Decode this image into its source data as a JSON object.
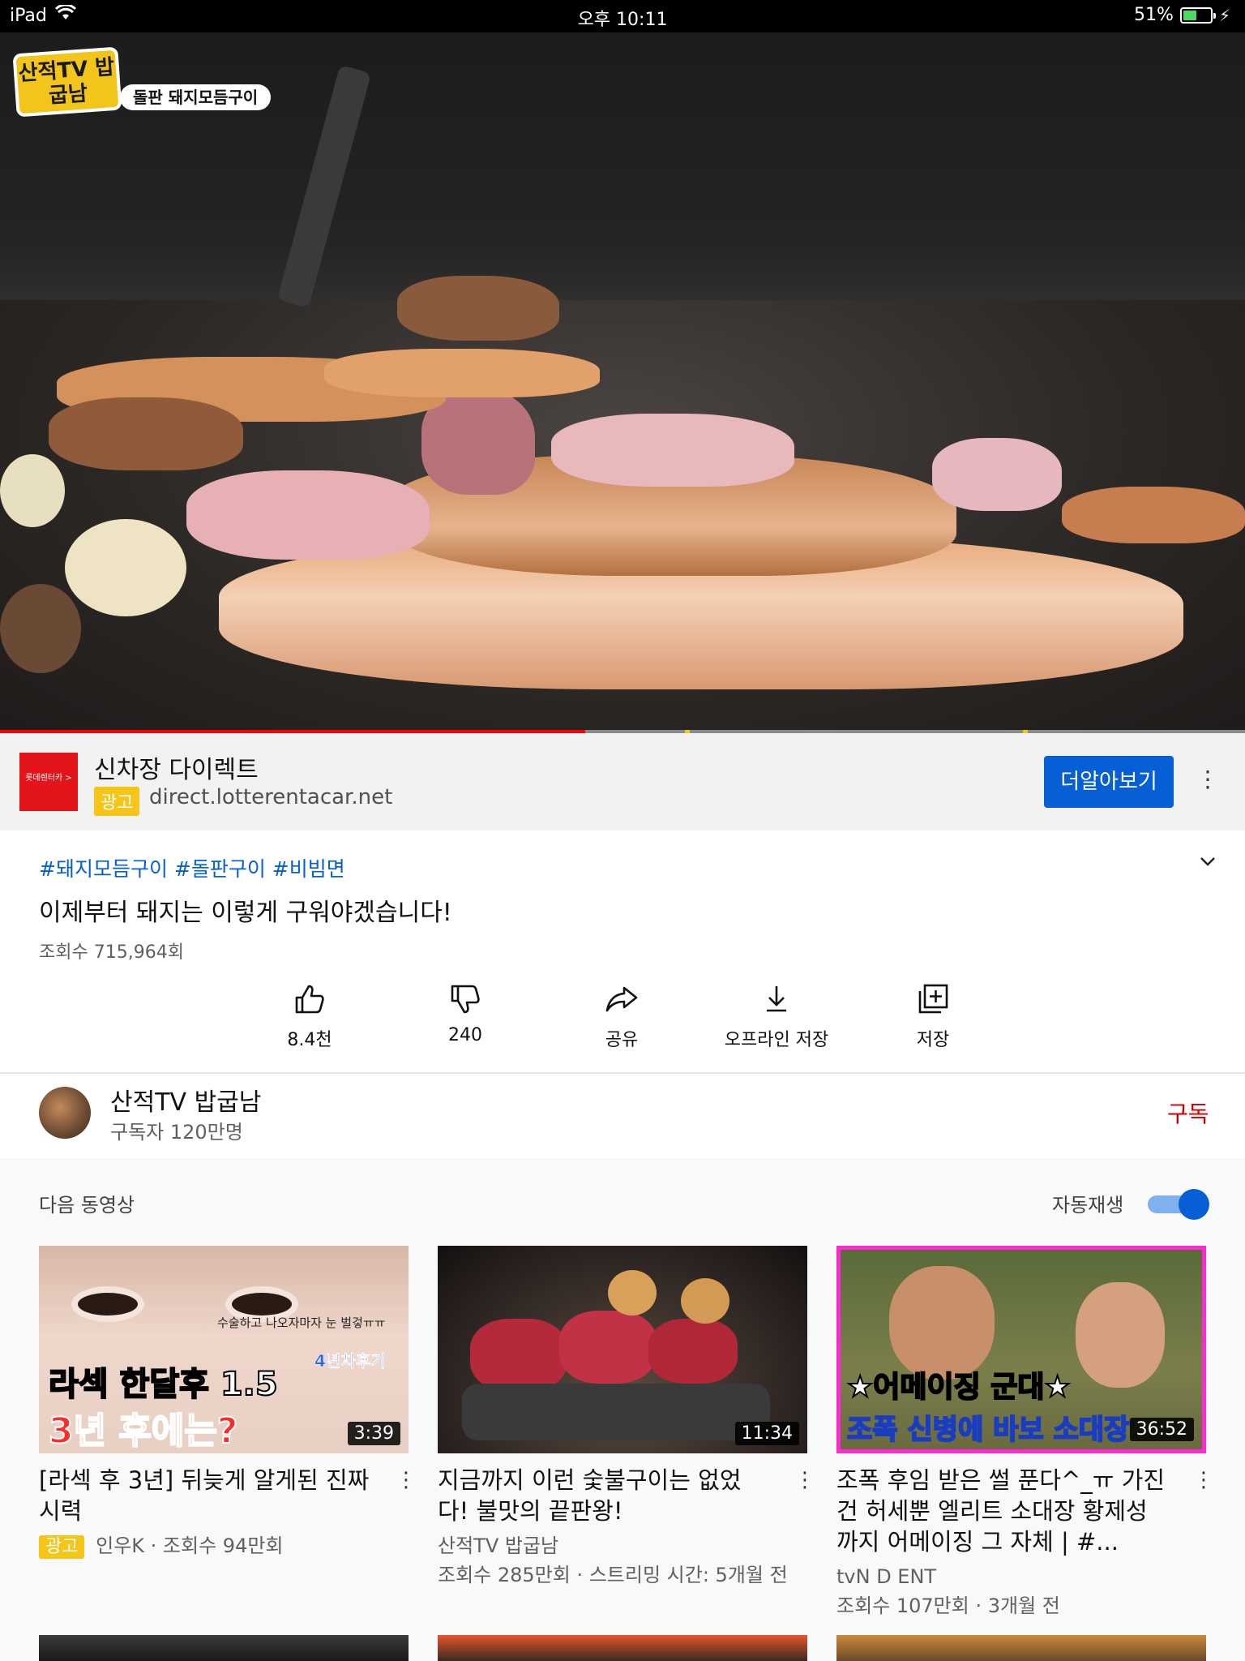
{
  "status_bar": {
    "device": "iPad",
    "time": "오후 10:11",
    "battery": "51%",
    "battery_level": 0.51
  },
  "video": {
    "channel_logo_text": "산적TV 밥굽남",
    "episode_label": "돌판 돼지모듬구이",
    "progress": 0.47
  },
  "ad": {
    "logo_text": "롯데렌터카 >",
    "title": "신차장 다이렉트",
    "badge": "광고",
    "url": "direct.lotterentacar.net",
    "cta": "더알아보기"
  },
  "info": {
    "hashtags": "#돼지모듬구이 #돌판구이 #비빔면",
    "title": "이제부터 돼지는 이렇게 구워야겠습니다!",
    "views": "조회수 715,964회"
  },
  "actions": [
    {
      "icon": "thumbs-up-icon",
      "label": "8.4천"
    },
    {
      "icon": "thumbs-down-icon",
      "label": "240"
    },
    {
      "icon": "share-icon",
      "label": "공유"
    },
    {
      "icon": "download-icon",
      "label": "오프라인 저장"
    },
    {
      "icon": "add-to-playlist-icon",
      "label": "저장"
    }
  ],
  "channel": {
    "name": "산적TV 밥굽남",
    "subscribers": "구독자 120만명",
    "subscribe_label": "구독"
  },
  "up_next": {
    "label": "다음 동영상",
    "autoplay_label": "자동재생",
    "autoplay_on": true,
    "videos": [
      {
        "title": "[라섹 후 3년] 뒤늦게 알게된 진짜 시력",
        "badge": "광고",
        "meta": "인우K · 조회수 94만회",
        "duration": "3:39",
        "thumb_text_1": "라섹 한달후 1.5",
        "thumb_text_2": "3년 후에는?",
        "thumb_text_3": "수술하고 나오자마자 눈 벌겋ㅠㅠ",
        "thumb_text_4": "4년차후기"
      },
      {
        "title": "지금까지 이런 숯불구이는 없었다! 불맛의 끝판왕!",
        "channel": "산적TV 밥굽남",
        "meta": "조회수 285만회 · 스트리밍 시간: 5개월 전",
        "duration": "11:34"
      },
      {
        "title": "조폭 후임 받은 썰 푼다^_ㅠ 가진 건 허세뿐 엘리트 소대장 황제성까지 어메이징 그 자체 | #...",
        "channel": "tvN D ENT",
        "meta": "조회수 107만회 · 3개월 전",
        "duration": "36:52",
        "thumb_text_1": "★어메이징 군대★",
        "thumb_text_2": "조폭 신병에 바보 소대장"
      }
    ]
  }
}
